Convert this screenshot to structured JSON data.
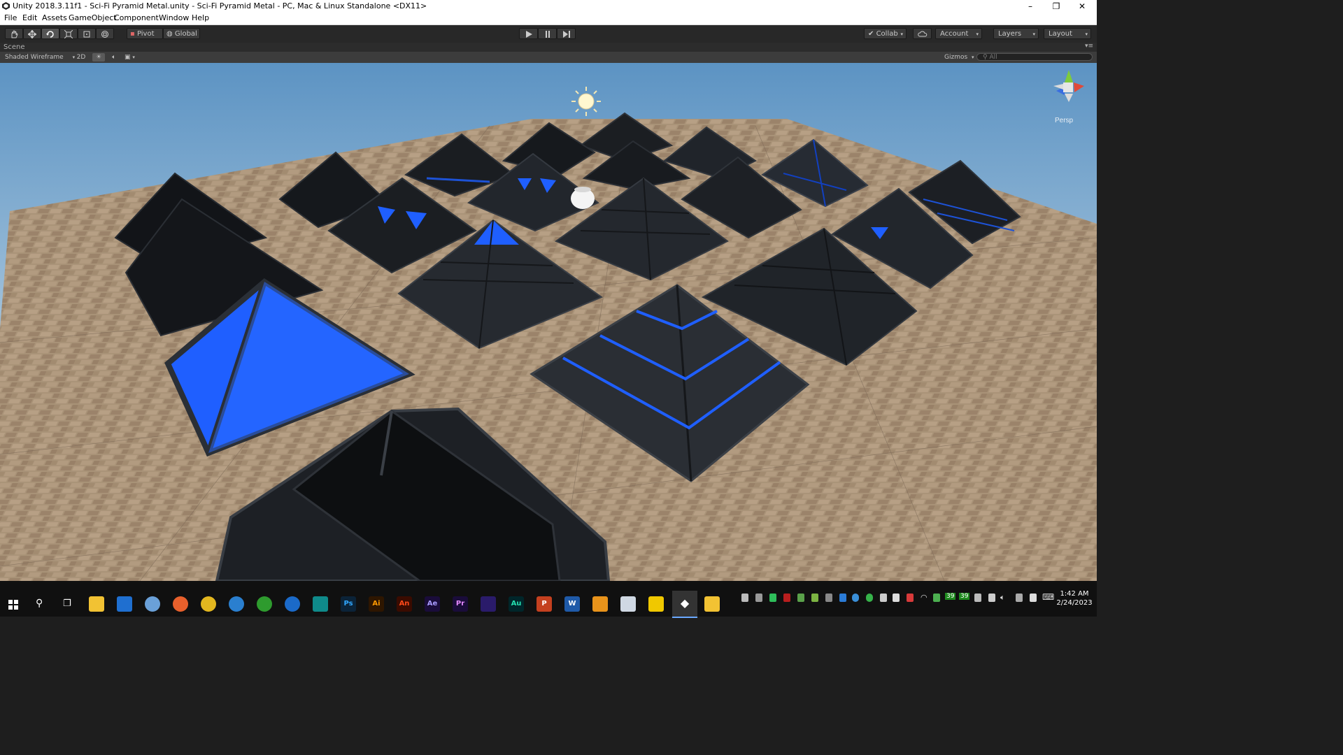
{
  "window": {
    "title": "Unity 2018.3.11f1 - Sci-Fi Pyramid Metal.unity - Sci-Fi Pyramid Metal - PC, Mac & Linux Standalone <DX11>",
    "minimize": "–",
    "restore": "❐",
    "close": "✕"
  },
  "menu": [
    "File",
    "Edit",
    "Assets",
    "GameObject",
    "Component",
    "Window",
    "Help"
  ],
  "toolbar": {
    "tools": [
      "hand-tool",
      "move-tool",
      "rotate-tool",
      "scale-tool",
      "rect-tool",
      "transform-tool"
    ],
    "pivot": "Pivot",
    "global": "Global",
    "collab": "Collab",
    "account": "Account",
    "layers": "Layers",
    "layout": "Layout"
  },
  "scene": {
    "tab": "Scene",
    "shading_mode": "Shaded Wireframe",
    "mode_2d": "2D",
    "gizmos": "Gizmos",
    "search_placeholder": "All",
    "projection": "Persp"
  },
  "taskbar": {
    "apps": [
      "Ps",
      "Ai",
      "An",
      "Ae",
      "Pr",
      "Au",
      "P",
      "W"
    ],
    "tray_counts": [
      "39",
      "39"
    ],
    "time": "1:42 AM",
    "date": "2/24/2023"
  },
  "colors": {
    "accent_blue": "#1f5fff",
    "editor_dark": "#282828",
    "sky_top": "#5d93c2",
    "floor": "#b59a7e"
  }
}
